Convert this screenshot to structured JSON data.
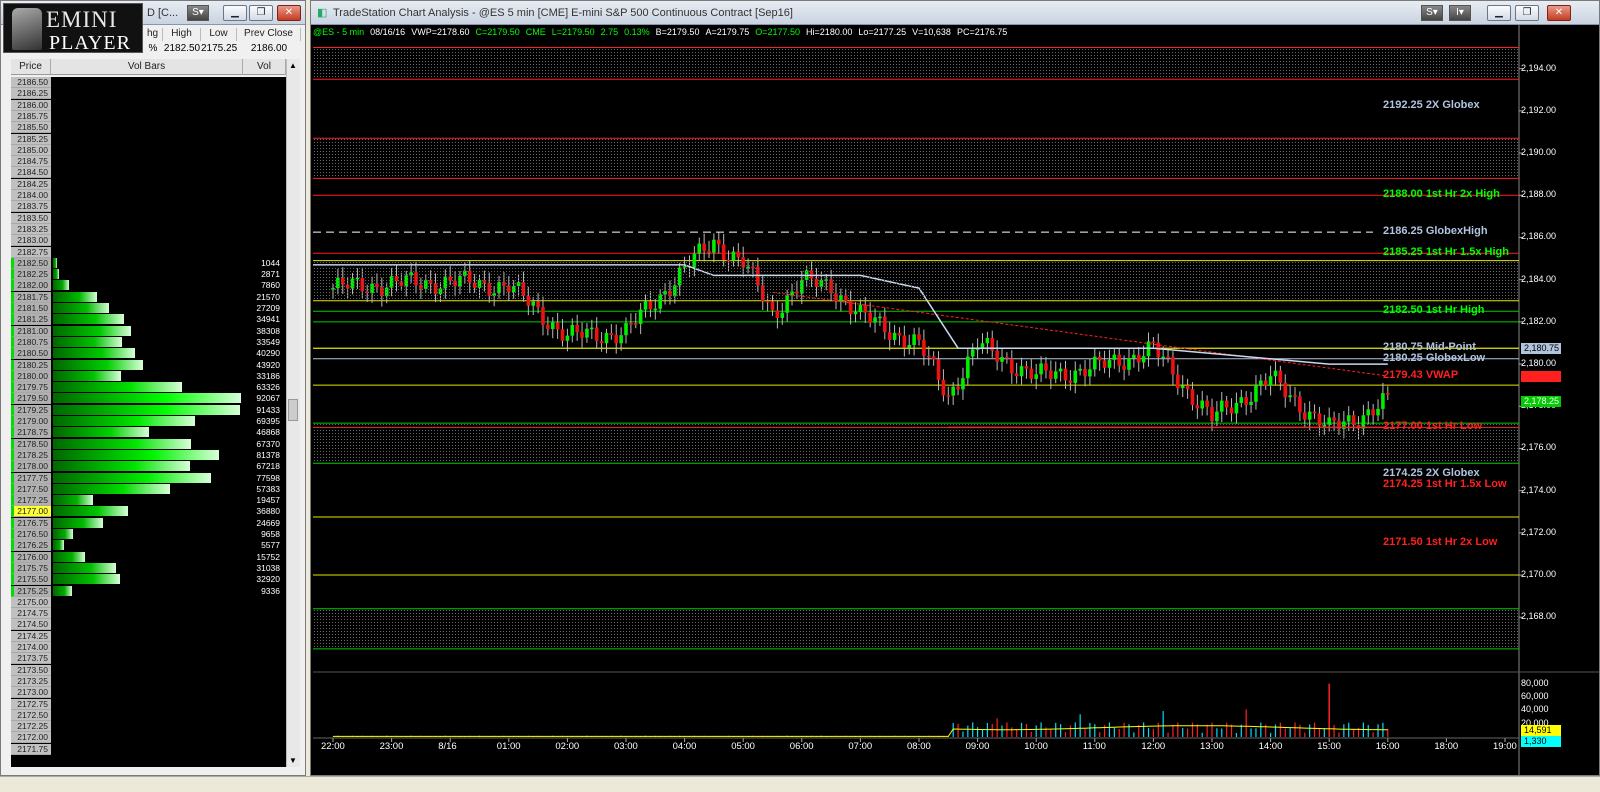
{
  "left_window": {
    "logo_line1": "EMINI",
    "logo_line2": "PLAYER",
    "title_fragment": "D [C...",
    "quote_headers": [
      "hg",
      "High",
      "Low",
      "Prev Close"
    ],
    "quote_values": [
      "%",
      "2182.50",
      "2175.25",
      "2186.00"
    ],
    "grid_headers": {
      "price": "Price",
      "vol_bars": "Vol Bars",
      "vol": "Vol"
    },
    "last_price": "2177.00",
    "ladder": [
      {
        "p": "2186.50",
        "v": ""
      },
      {
        "p": "2186.25",
        "v": ""
      },
      {
        "p": "2186.00",
        "v": ""
      },
      {
        "p": "2185.75",
        "v": ""
      },
      {
        "p": "2185.50",
        "v": ""
      },
      {
        "p": "2185.25",
        "v": ""
      },
      {
        "p": "2185.00",
        "v": ""
      },
      {
        "p": "2184.75",
        "v": ""
      },
      {
        "p": "2184.50",
        "v": ""
      },
      {
        "p": "2184.25",
        "v": ""
      },
      {
        "p": "2184.00",
        "v": ""
      },
      {
        "p": "2183.75",
        "v": ""
      },
      {
        "p": "2183.50",
        "v": ""
      },
      {
        "p": "2183.25",
        "v": ""
      },
      {
        "p": "2183.00",
        "v": ""
      },
      {
        "p": "2182.75",
        "v": ""
      },
      {
        "p": "2182.50",
        "v": "1044"
      },
      {
        "p": "2182.25",
        "v": "2871"
      },
      {
        "p": "2182.00",
        "v": "7860"
      },
      {
        "p": "2181.75",
        "v": "21570"
      },
      {
        "p": "2181.50",
        "v": "27209"
      },
      {
        "p": "2181.25",
        "v": "34941"
      },
      {
        "p": "2181.00",
        "v": "38308"
      },
      {
        "p": "2180.75",
        "v": "33549"
      },
      {
        "p": "2180.50",
        "v": "40290"
      },
      {
        "p": "2180.25",
        "v": "43920"
      },
      {
        "p": "2180.00",
        "v": "33186"
      },
      {
        "p": "2179.75",
        "v": "63326"
      },
      {
        "p": "2179.50",
        "v": "92067"
      },
      {
        "p": "2179.25",
        "v": "91433"
      },
      {
        "p": "2179.00",
        "v": "69395"
      },
      {
        "p": "2178.75",
        "v": "46868"
      },
      {
        "p": "2178.50",
        "v": "67370"
      },
      {
        "p": "2178.25",
        "v": "81378"
      },
      {
        "p": "2178.00",
        "v": "67218"
      },
      {
        "p": "2177.75",
        "v": "77598"
      },
      {
        "p": "2177.50",
        "v": "57383"
      },
      {
        "p": "2177.25",
        "v": "19457"
      },
      {
        "p": "2177.00",
        "v": "36880"
      },
      {
        "p": "2176.75",
        "v": "24669"
      },
      {
        "p": "2176.50",
        "v": "9658"
      },
      {
        "p": "2176.25",
        "v": "5577"
      },
      {
        "p": "2176.00",
        "v": "15752"
      },
      {
        "p": "2175.75",
        "v": "31038"
      },
      {
        "p": "2175.50",
        "v": "32920"
      },
      {
        "p": "2175.25",
        "v": "9336"
      },
      {
        "p": "2175.00",
        "v": ""
      },
      {
        "p": "2174.75",
        "v": ""
      },
      {
        "p": "2174.50",
        "v": ""
      },
      {
        "p": "2174.25",
        "v": ""
      },
      {
        "p": "2174.00",
        "v": ""
      },
      {
        "p": "2173.75",
        "v": ""
      },
      {
        "p": "2173.50",
        "v": ""
      },
      {
        "p": "2173.25",
        "v": ""
      },
      {
        "p": "2173.00",
        "v": ""
      },
      {
        "p": "2172.75",
        "v": ""
      },
      {
        "p": "2172.50",
        "v": ""
      },
      {
        "p": "2172.25",
        "v": ""
      },
      {
        "p": "2172.00",
        "v": ""
      },
      {
        "p": "2171.75",
        "v": ""
      }
    ]
  },
  "chart_window": {
    "title": "TradeStation Chart Analysis - @ES 5 min [CME] E-mini S&P 500 Continuous Contract [Sep16]",
    "data_line": [
      {
        "t": "@ES - 5 min",
        "c": "#00ff00"
      },
      {
        "t": "08/16/16",
        "c": "#ffffff"
      },
      {
        "t": "VWP=2178.60",
        "c": "#ffffff"
      },
      {
        "t": "C=2179.50",
        "c": "#00ff00"
      },
      {
        "t": "CME",
        "c": "#00ff00"
      },
      {
        "t": "L=2179.50",
        "c": "#00ff00"
      },
      {
        "t": "2.75",
        "c": "#00ff00"
      },
      {
        "t": "0.13%",
        "c": "#00ff00"
      },
      {
        "t": "B=2179.50",
        "c": "#ffffff"
      },
      {
        "t": "A=2179.75",
        "c": "#ffffff"
      },
      {
        "t": "O=2177.50",
        "c": "#00ff00"
      },
      {
        "t": "Hi=2180.00",
        "c": "#ffffff"
      },
      {
        "t": "Lo=2177.25",
        "c": "#ffffff"
      },
      {
        "t": "V=10,638",
        "c": "#ffffff"
      },
      {
        "t": "PC=2176.75",
        "c": "#ffffff"
      }
    ],
    "levels": [
      {
        "label": "2192.25 2X Globex",
        "price": 2192.25,
        "color": "#b0c4de",
        "line": "none"
      },
      {
        "label": "2188.00 1st Hr  2x High",
        "price": 2188.0,
        "color": "#00ff00",
        "line": "#ff2020"
      },
      {
        "label": "2186.25 GlobexHigh",
        "price": 2186.25,
        "color": "#b0c4de",
        "line": "dash"
      },
      {
        "label": "2185.25 1st Hr  1.5x High",
        "price": 2185.25,
        "color": "#00ff00",
        "line": "#ff2020"
      },
      {
        "label": "2182.50 1st Hr  High",
        "price": 2182.5,
        "color": "#00ff00",
        "line": "#00cc00"
      },
      {
        "label": "2180.75 Mid-Point",
        "price": 2180.75,
        "color": "#b0c4de",
        "line": "#e6e600"
      },
      {
        "label": "2180.25 GlobexLow",
        "price": 2180.25,
        "color": "#b0c4de",
        "line": "#b0c4de"
      },
      {
        "label": "2179.43 VWAP",
        "price": 2179.43,
        "color": "#ff2020",
        "line": "none"
      },
      {
        "label": "2177.00 1st Hr  Low",
        "price": 2177.0,
        "color": "#ff2020",
        "line": "#ff2020"
      },
      {
        "label": "2174.25 2X Globex",
        "price": 2174.25,
        "color": "#b0c4de",
        "line": "none"
      },
      {
        "label": "2174.25 1st Hr  1.5x Low",
        "price": 2174.25,
        "color": "#ff2020",
        "line": "none"
      },
      {
        "label": "2171.50 1st Hr  2x Low",
        "price": 2171.5,
        "color": "#ff2020",
        "line": "none"
      }
    ],
    "price_markers": [
      {
        "label": "2,180.75",
        "price": 2180.75,
        "bg": "#b0c4de",
        "fg": "#000000"
      },
      {
        "label": "2,179.43",
        "price": 2179.43,
        "bg": "#ff2020",
        "fg": "#ff2020"
      },
      {
        "label": "2,178.25",
        "price": 2178.25,
        "bg": "#00cc00",
        "fg": "#ffffff"
      }
    ],
    "y_ticks": [
      "2,194.00",
      "2,192.00",
      "2,190.00",
      "2,188.00",
      "2,186.00",
      "2,184.00",
      "2,182.00",
      "2,180.00",
      "2,178.00",
      "2,176.00",
      "2,174.00",
      "2,172.00",
      "2,170.00",
      "2,168.00"
    ],
    "vol_ticks": [
      "80,000",
      "60,000",
      "40,000",
      "20,000"
    ],
    "vol_markers": [
      {
        "label": "14,591",
        "bg": "#ffff00"
      },
      {
        "label": "1,330",
        "bg": "#00ffff"
      }
    ],
    "x_ticks": [
      "22:00",
      "23:00",
      "8/16",
      "01:00",
      "02:00",
      "03:00",
      "04:00",
      "05:00",
      "06:00",
      "07:00",
      "08:00",
      "09:00",
      "10:00",
      "11:00",
      "12:00",
      "13:00",
      "14:00",
      "15:00",
      "16:00",
      "18:00",
      "19:00"
    ]
  },
  "chart_data": {
    "type": "candlestick",
    "symbol": "@ES 5 min",
    "ylim": [
      2165.5,
      2195.5
    ],
    "x_categories": [
      "22:00",
      "23:00",
      "8/16",
      "01:00",
      "02:00",
      "03:00",
      "04:00",
      "05:00",
      "06:00",
      "07:00",
      "08:00",
      "09:00",
      "10:00",
      "11:00",
      "12:00",
      "13:00",
      "14:00",
      "15:00",
      "16:00",
      "18:00",
      "19:00"
    ],
    "approx_close_path": [
      {
        "t": "22:00",
        "v": 2183.6
      },
      {
        "t": "23:00",
        "v": 2183.8
      },
      {
        "t": "8/16",
        "v": 2183.9
      },
      {
        "t": "01:00",
        "v": 2183.7
      },
      {
        "t": "02:00",
        "v": 2181.3
      },
      {
        "t": "03:00",
        "v": 2181.5
      },
      {
        "t": "04:00",
        "v": 2184.5
      },
      {
        "t": "04:30",
        "v": 2185.8
      },
      {
        "t": "05:00",
        "v": 2184.8
      },
      {
        "t": "05:30",
        "v": 2182.4
      },
      {
        "t": "06:00",
        "v": 2183.9
      },
      {
        "t": "06:30",
        "v": 2183.7
      },
      {
        "t": "07:00",
        "v": 2182.3
      },
      {
        "t": "08:00",
        "v": 2180.9
      },
      {
        "t": "08:30",
        "v": 2178.5
      },
      {
        "t": "09:00",
        "v": 2180.9
      },
      {
        "t": "10:00",
        "v": 2179.4
      },
      {
        "t": "11:00",
        "v": 2179.8
      },
      {
        "t": "12:00",
        "v": 2180.7
      },
      {
        "t": "13:00",
        "v": 2177.4
      },
      {
        "t": "14:00",
        "v": 2179.3
      },
      {
        "t": "15:00",
        "v": 2176.9
      },
      {
        "t": "15:30",
        "v": 2177.5
      },
      {
        "t": "16:00",
        "v": 2178.25
      }
    ],
    "vwap_start": "05:30",
    "vwap_end": 2179.43,
    "volume_ylim": [
      0,
      90000
    ]
  }
}
